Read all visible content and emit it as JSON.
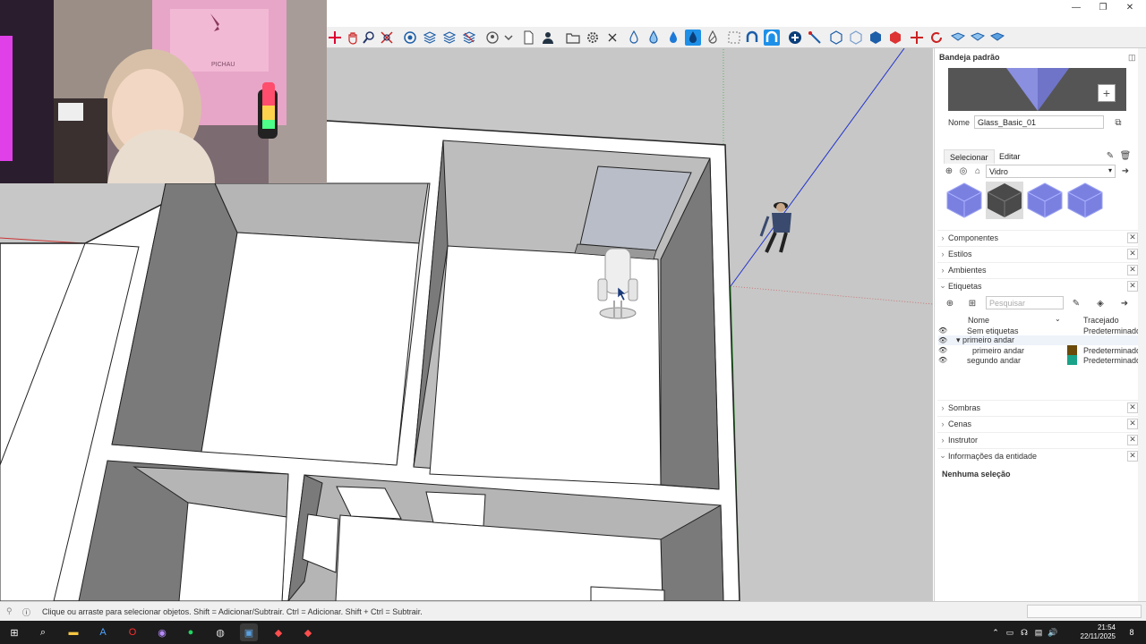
{
  "window": {
    "minimize": "—",
    "maximize": "❐",
    "close": "✕"
  },
  "tray": {
    "title": "Bandeja padrão",
    "material": {
      "name_label": "Nome",
      "name_value": "Glass_Basic_01",
      "tab_select": "Selecionar",
      "tab_edit": "Editar",
      "collection": "Vidro"
    },
    "sections": {
      "components": "Componentes",
      "styles": "Estilos",
      "environments": "Ambientes",
      "tags": "Etiquetas",
      "shadows": "Sombras",
      "scenes": "Cenas",
      "instructor": "Instrutor",
      "entity_info": "Informações da entidade"
    },
    "tags": {
      "search_placeholder": "Pesquisar",
      "col_name": "Nome",
      "col_dash": "Tracejado",
      "rows": [
        {
          "name": "Sem etiquetas",
          "dash": "Predeterminado",
          "indent": 0,
          "color": ""
        },
        {
          "name": "primeiro andar",
          "dash": "",
          "indent": 1,
          "color": ""
        },
        {
          "name": "primeiro andar",
          "dash": "Predeterminado",
          "indent": 2,
          "color": "#6b4a0a"
        },
        {
          "name": "segundo andar",
          "dash": "Predeterminado",
          "indent": 0,
          "color": "#1aa388"
        }
      ]
    },
    "entity_info_text": "Nenhuma seleção"
  },
  "status": {
    "message": "Clique ou arraste para selecionar objetos. Shift = Adicionar/Subtrair. Ctrl = Adicionar. Shift + Ctrl = Subtrair."
  },
  "clock": {
    "time": "21:54",
    "date": "22/11/2025",
    "notifications": "8"
  },
  "webcam": {
    "chair_text": "PICHAU"
  },
  "colors": {
    "accent": "#1e90e8",
    "viewport_bg": "#c7c7c7"
  }
}
